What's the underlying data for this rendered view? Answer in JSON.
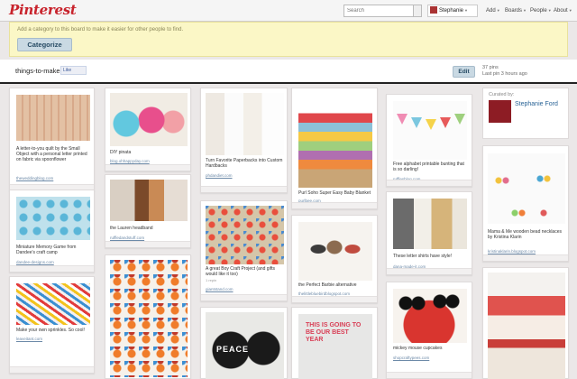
{
  "header": {
    "logo": "Pinterest",
    "search_placeholder": "Search",
    "user": "Stephanie",
    "nav": [
      "Add",
      "Boards",
      "People",
      "About"
    ]
  },
  "banner": {
    "text": "Add a category to this board to make it easier for other people to find.",
    "button": "Categorize"
  },
  "board": {
    "title": "things-to-make",
    "like": "Like",
    "edit": "Edit",
    "pins": "37 pins",
    "last_pin": "Last pin 3 hours ago"
  },
  "curator": {
    "label": "Curated by:",
    "name": "Stephanie Ford"
  },
  "pins": [
    {
      "desc": "A letter-to-you quilt by the Small Object with a personal letter printed on fabric via spoonflower",
      "src": "theweddingblog.com"
    },
    {
      "desc": "Miniature Memory Game from Dandee's craft camp",
      "src": "dandee-designs.com"
    },
    {
      "desc": "Make your own sprinkles. So cool!",
      "src": "leaveitant.com"
    },
    {
      "desc": "DIY pinata",
      "src": "blog.ohhappyday.com"
    },
    {
      "desc": "the Lauren headband",
      "src": "ruffledandstuff.com"
    },
    {
      "desc": "Turn Favorite Paperbacks into Custom Hardbacks",
      "src": "phdandiet.com"
    },
    {
      "desc": "A great Boy Craft Project (and gifts would like it too)",
      "src": "giantstand.com",
      "repin": "1 repin"
    },
    {
      "desc": "Purl Soho Super Easy Baby Blanket",
      "src": "purlbee.com"
    },
    {
      "desc": "the Perfect Barbie alternative",
      "src": "thelittlebluebirdblogspot.com"
    },
    {
      "desc": "Free alphabet printable bunting that is so darling!",
      "src": "rufflesblog.com"
    },
    {
      "desc": "These letter shirts have style!",
      "src": "dana-made-it.com"
    },
    {
      "desc": "mickey mouse cupcakes",
      "src": "shopcraftypees.com"
    },
    {
      "desc": "Mama & Me wooden bead necklaces by Kristina Klarin",
      "src": "kristinaklarin.blogspot.com"
    }
  ],
  "graphic_text": {
    "peace": "PEACE",
    "best": "THIS IS GOING TO BE OUR BEST YEAR"
  },
  "colors": {
    "brand": "#c8232c",
    "button": "#c9d9e3",
    "banner": "#fbf7c6"
  }
}
